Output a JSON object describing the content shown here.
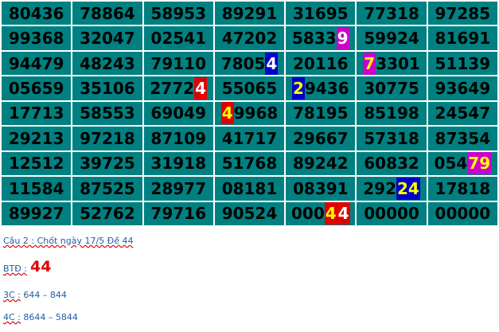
{
  "colors": {
    "cell_bg": "#008080",
    "cell_text": "#000000",
    "highlight_text": "#ffffff",
    "highlight_text_alt": "#ffff00",
    "highlight_red": "#e00000",
    "highlight_blue": "#0000cc",
    "highlight_magenta": "#cc00cc",
    "link_text": "#1f5ea8"
  },
  "grid": {
    "rows": [
      [
        [
          {
            "t": "80436"
          }
        ],
        [
          {
            "t": "78864"
          }
        ],
        [
          {
            "t": "58953"
          }
        ],
        [
          {
            "t": "89291"
          }
        ],
        [
          {
            "t": "31695"
          }
        ],
        [
          {
            "t": "77318"
          }
        ],
        [
          {
            "t": "97285"
          }
        ]
      ],
      [
        [
          {
            "t": "99368"
          }
        ],
        [
          {
            "t": "32047"
          }
        ],
        [
          {
            "t": "02541"
          }
        ],
        [
          {
            "t": "47202"
          }
        ],
        [
          {
            "t": "5833"
          },
          {
            "t": "9",
            "bg": "#cc00cc",
            "fg": "#ffffff"
          }
        ],
        [
          {
            "t": "59924"
          }
        ],
        [
          {
            "t": "81691"
          }
        ]
      ],
      [
        [
          {
            "t": "94479"
          }
        ],
        [
          {
            "t": "48243"
          }
        ],
        [
          {
            "t": "79110"
          }
        ],
        [
          {
            "t": "7805"
          },
          {
            "t": "4",
            "bg": "#0000cc",
            "fg": "#ffffff"
          }
        ],
        [
          {
            "t": "20116"
          }
        ],
        [
          {
            "t": "7",
            "bg": "#cc00cc",
            "fg": "#ffff00"
          },
          {
            "t": "3301"
          }
        ],
        [
          {
            "t": "51139"
          }
        ]
      ],
      [
        [
          {
            "t": "05659"
          }
        ],
        [
          {
            "t": "35106"
          }
        ],
        [
          {
            "t": "2772"
          },
          {
            "t": "4",
            "bg": "#e00000",
            "fg": "#ffffff"
          }
        ],
        [
          {
            "t": "55065"
          }
        ],
        [
          {
            "t": "2",
            "bg": "#0000cc",
            "fg": "#ffff00"
          },
          {
            "t": "9436"
          }
        ],
        [
          {
            "t": "30775"
          }
        ],
        [
          {
            "t": "93649"
          }
        ]
      ],
      [
        [
          {
            "t": "17713"
          }
        ],
        [
          {
            "t": "58553"
          }
        ],
        [
          {
            "t": "69049"
          }
        ],
        [
          {
            "t": "4",
            "bg": "#e00000",
            "fg": "#ffff00"
          },
          {
            "t": "9968"
          }
        ],
        [
          {
            "t": "78195"
          }
        ],
        [
          {
            "t": "85198"
          }
        ],
        [
          {
            "t": "24547"
          }
        ]
      ],
      [
        [
          {
            "t": "29213"
          }
        ],
        [
          {
            "t": "97218"
          }
        ],
        [
          {
            "t": "87109"
          }
        ],
        [
          {
            "t": "41717"
          }
        ],
        [
          {
            "t": "29667"
          }
        ],
        [
          {
            "t": "57318"
          }
        ],
        [
          {
            "t": "87354"
          }
        ]
      ],
      [
        [
          {
            "t": "12512"
          }
        ],
        [
          {
            "t": "39725"
          }
        ],
        [
          {
            "t": "31918"
          }
        ],
        [
          {
            "t": "51768"
          }
        ],
        [
          {
            "t": "89242"
          }
        ],
        [
          {
            "t": "60832"
          }
        ],
        [
          {
            "t": "054"
          },
          {
            "t": "79",
            "bg": "#cc00cc",
            "fg": "#ffff00"
          }
        ]
      ],
      [
        [
          {
            "t": "11584"
          }
        ],
        [
          {
            "t": "87525"
          }
        ],
        [
          {
            "t": "28977"
          }
        ],
        [
          {
            "t": "08181"
          }
        ],
        [
          {
            "t": "08391"
          }
        ],
        [
          {
            "t": "292"
          },
          {
            "t": "24",
            "bg": "#0000cc",
            "fg": "#ffff00"
          }
        ],
        [
          {
            "t": "17818"
          }
        ]
      ],
      [
        [
          {
            "t": "89927"
          }
        ],
        [
          {
            "t": "52762"
          }
        ],
        [
          {
            "t": "79716"
          }
        ],
        [
          {
            "t": "90524"
          }
        ],
        [
          {
            "t": "000"
          },
          {
            "t": "4",
            "bg": "#e00000",
            "fg": "#ffff00"
          },
          {
            "t": "4",
            "bg": "#e00000",
            "fg": "#ffffff"
          }
        ],
        [
          {
            "t": "00000"
          }
        ],
        [
          {
            "t": "00000"
          }
        ]
      ]
    ]
  },
  "notes": {
    "cau2_label": "Câu 2 : Chốt ngày 17/5 Đề 44",
    "btd_label": "BTĐ :",
    "btd_value": "44",
    "c3_label": "3C :",
    "c3_value": "644 – 844",
    "c4_label": "4C :",
    "c4_value": "8644 – 5844"
  }
}
